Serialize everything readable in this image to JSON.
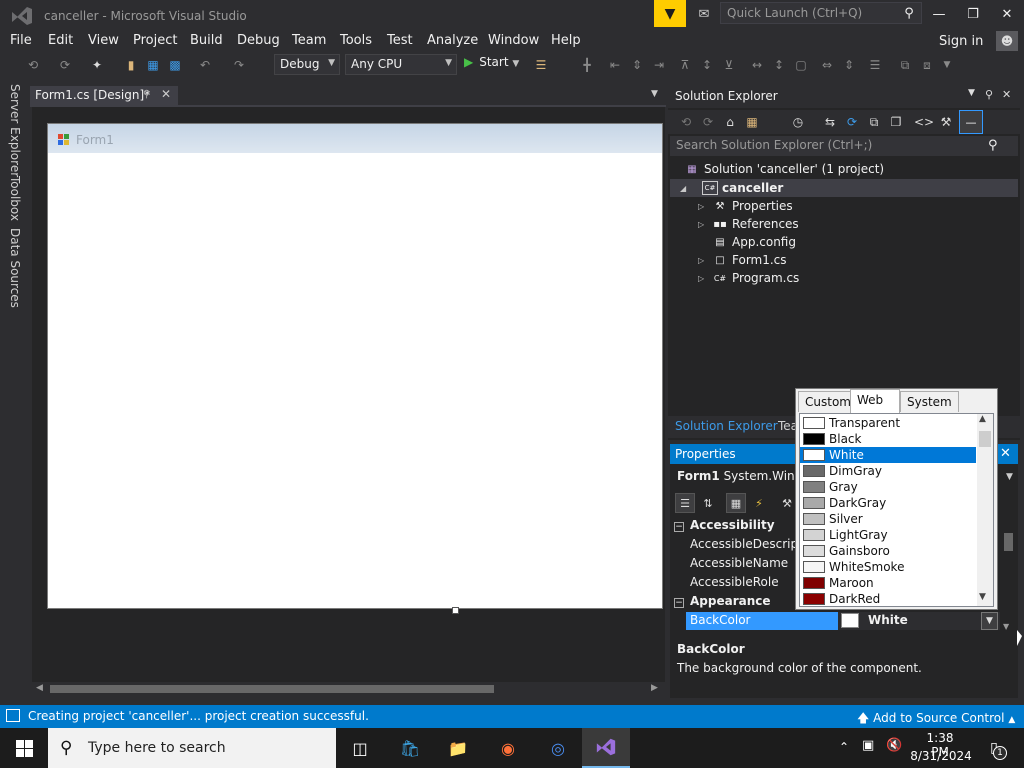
{
  "window": {
    "title": "canceller - Microsoft Visual Studio",
    "quick_launch_placeholder": "Quick Launch (Ctrl+Q)",
    "sign_in": "Sign in"
  },
  "menu": [
    "File",
    "Edit",
    "View",
    "Project",
    "Build",
    "Debug",
    "Team",
    "Tools",
    "Test",
    "Analyze",
    "Window",
    "Help"
  ],
  "toolbar": {
    "config": "Debug",
    "platform": "Any CPU",
    "start": "Start"
  },
  "left_tabs": [
    "Server Explorer",
    "Toolbox",
    "Data Sources"
  ],
  "document": {
    "tab": "Form1.cs [Design]*",
    "form_title": "Form1"
  },
  "solution_explorer": {
    "title": "Solution Explorer",
    "search_placeholder": "Search Solution Explorer (Ctrl+;)",
    "solution": "Solution 'canceller' (1 project)",
    "project": "canceller",
    "items": [
      "Properties",
      "References",
      "App.config",
      "Form1.cs",
      "Program.cs"
    ],
    "bottom_tabs": [
      "Solution Explorer",
      "Team Explorer"
    ]
  },
  "properties": {
    "title": "Properties",
    "object_name": "Form1",
    "object_type": "System.Windows.Forms.Form",
    "categories": {
      "accessibility": "Accessibility",
      "appearance": "Appearance"
    },
    "rows": [
      "AccessibleDescription",
      "AccessibleName",
      "AccessibleRole"
    ],
    "selected_property": "BackColor",
    "selected_value": "White",
    "description_title": "BackColor",
    "description_text": "The background color of the component."
  },
  "color_picker": {
    "tabs": [
      "Custom",
      "Web",
      "System"
    ],
    "selected_tab": "Web",
    "selected_color": "White",
    "colors": [
      {
        "name": "Transparent",
        "hex": "#ffffff"
      },
      {
        "name": "Black",
        "hex": "#000000"
      },
      {
        "name": "White",
        "hex": "#ffffff"
      },
      {
        "name": "DimGray",
        "hex": "#696969"
      },
      {
        "name": "Gray",
        "hex": "#808080"
      },
      {
        "name": "DarkGray",
        "hex": "#a9a9a9"
      },
      {
        "name": "Silver",
        "hex": "#c0c0c0"
      },
      {
        "name": "LightGray",
        "hex": "#d3d3d3"
      },
      {
        "name": "Gainsboro",
        "hex": "#dcdcdc"
      },
      {
        "name": "WhiteSmoke",
        "hex": "#f5f5f5"
      },
      {
        "name": "Maroon",
        "hex": "#800000"
      },
      {
        "name": "DarkRed",
        "hex": "#8b0000"
      }
    ]
  },
  "status": {
    "message": "Creating project 'canceller'... project creation successful.",
    "source_control": "Add to Source Control"
  },
  "taskbar": {
    "search_placeholder": "Type here to search",
    "time": "1:38 PM",
    "date": "8/31/2024",
    "notification_count": "1"
  },
  "colors": {
    "accent": "#007acc",
    "selection": "#0078d7"
  }
}
